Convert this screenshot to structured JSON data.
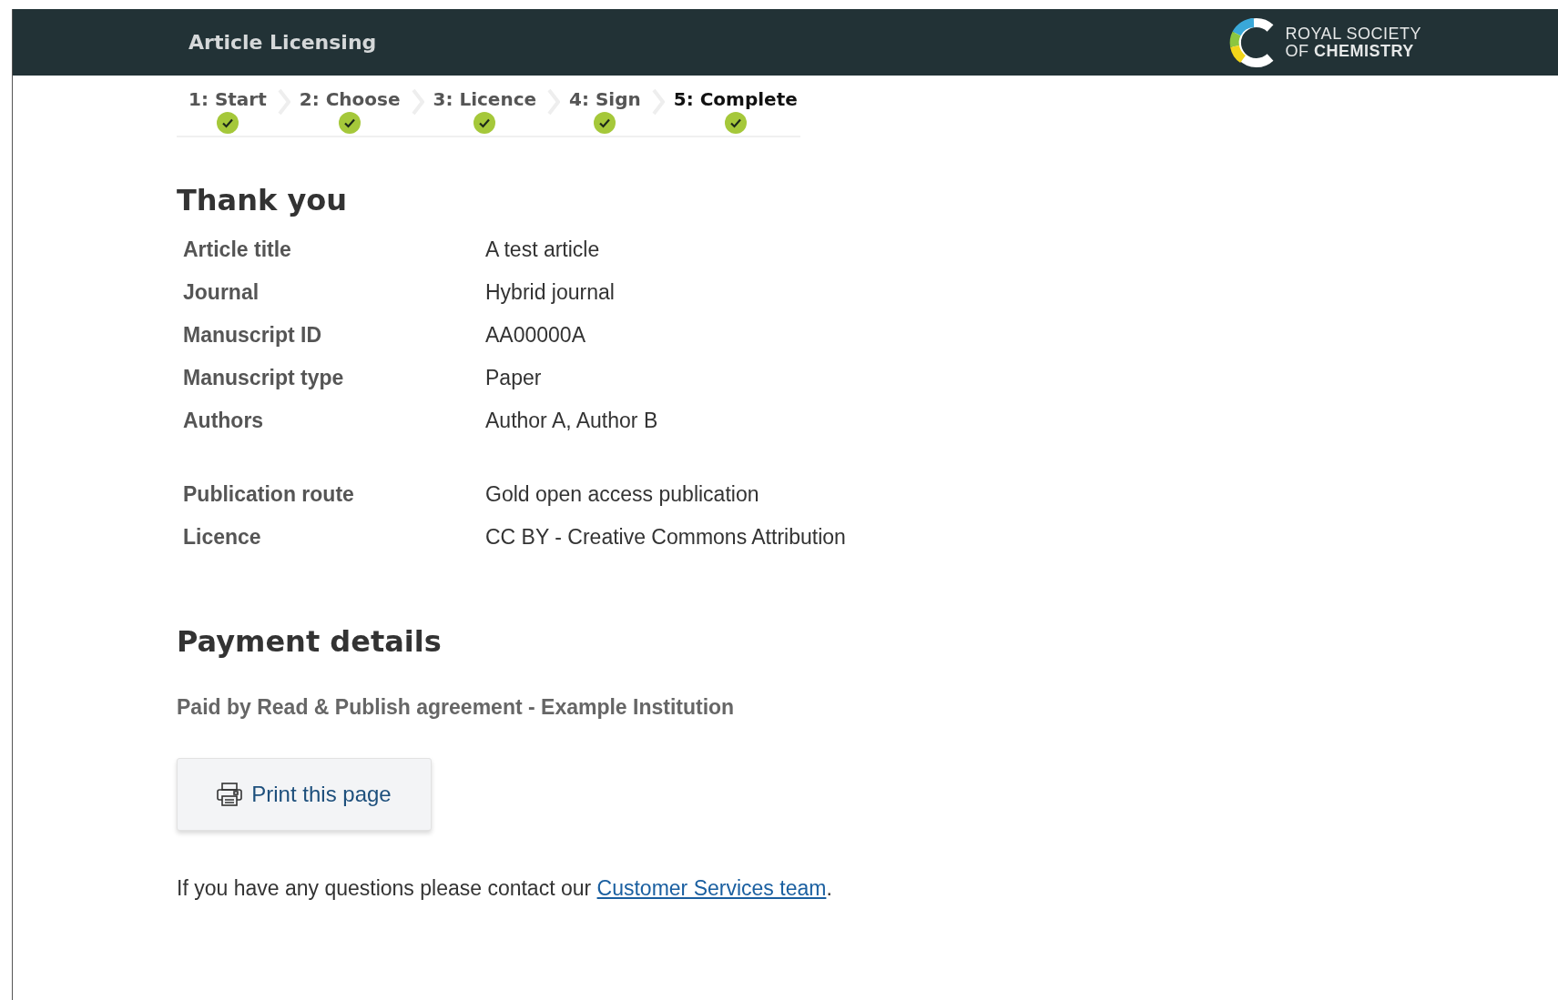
{
  "header": {
    "title": "Article Licensing",
    "logo_lines": [
      "ROYAL SOCIETY",
      "OF **CHEMISTRY**"
    ]
  },
  "steps": [
    {
      "label": "1: Start",
      "completed": true,
      "selected": false
    },
    {
      "label": "2: Choose",
      "completed": true,
      "selected": false
    },
    {
      "label": "3: Licence",
      "completed": true,
      "selected": false
    },
    {
      "label": "4: Sign",
      "completed": true,
      "selected": false
    },
    {
      "label": "5: Complete",
      "completed": true,
      "selected": true
    }
  ],
  "heading": "Thank you",
  "details": [
    {
      "label": "Article title",
      "value": "A test article"
    },
    {
      "label": "Journal",
      "value": "Hybrid journal"
    },
    {
      "label": "Manuscript ID",
      "value": "AA00000A"
    },
    {
      "label": "Manuscript type",
      "value": "Paper"
    },
    {
      "label": "Authors",
      "value": "Author A, Author B"
    }
  ],
  "publication": [
    {
      "label": "Publication route",
      "value": "Gold open access publication"
    },
    {
      "label": "Licence",
      "value": "CC BY - Creative Commons Attribution"
    }
  ],
  "payment": {
    "heading": "Payment details",
    "text": "Paid by Read & Publish agreement - Example Institution"
  },
  "print_button": "Print this page",
  "contact": {
    "text": "If you have any questions please contact our ",
    "link": "Customer Services team",
    "after": "."
  }
}
